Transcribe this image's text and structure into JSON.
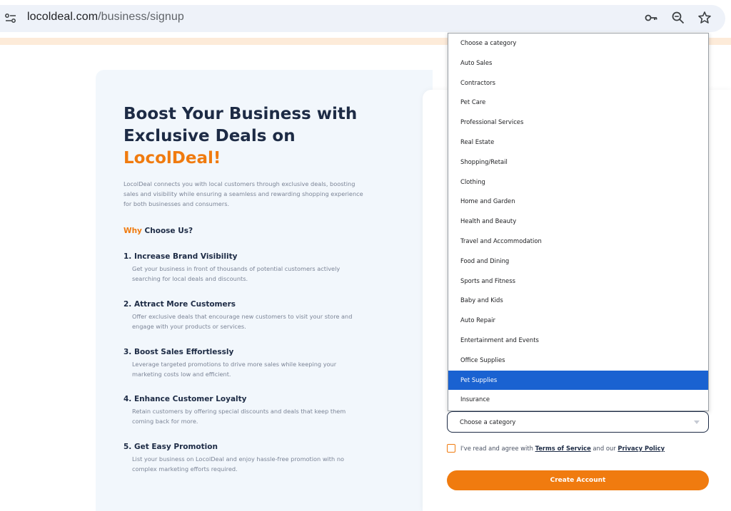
{
  "browser": {
    "url_domain": "locoldeal.com",
    "url_path": "/business/signup"
  },
  "hero": {
    "headline_line1": "Boost Your Business with",
    "headline_line2": "Exclusive Deals on",
    "brand": "LocolDeal!",
    "intro": "LocolDeal connects you with local customers through exclusive deals, boosting sales and visibility while ensuring a seamless and rewarding shopping experience for both businesses and consumers.",
    "why_accent": "Why",
    "why_rest": " Choose Us?"
  },
  "benefits": [
    {
      "title": "1. Increase Brand Visibility",
      "desc": "Get your business in front of thousands of potential customers actively searching for local deals and discounts."
    },
    {
      "title": "2. Attract More Customers",
      "desc": "Offer exclusive deals that encourage new customers to visit your store and engage with your products or services."
    },
    {
      "title": "3. Boost Sales Effortlessly",
      "desc": "Leverage targeted promotions to drive more sales while keeping your marketing costs low and efficient."
    },
    {
      "title": "4. Enhance Customer Loyalty",
      "desc": "Retain customers by offering special discounts and deals that keep them coming back for more."
    },
    {
      "title": "5. Get Easy Promotion",
      "desc": "List your business on LocolDeal and enjoy hassle-free promotion with no complex marketing efforts required."
    }
  ],
  "category_dropdown": {
    "options": [
      "Choose a category",
      "Auto Sales",
      "Contractors",
      "Pet Care",
      "Professional Services",
      "Real Estate",
      "Shopping/Retail",
      "Clothing",
      "Home and Garden",
      "Health and Beauty",
      "Travel and Accommodation",
      "Food and Dining",
      "Sports and Fitness",
      "Baby and Kids",
      "Auto Repair",
      "Entertainment and Events",
      "Office Supplies",
      "Pet Supplies",
      "Insurance"
    ],
    "highlighted": "Pet Supplies",
    "selected_value": "Choose a category"
  },
  "agreement": {
    "prefix": "I've read and agree with ",
    "terms": "Terms of Service",
    "middle": " and our ",
    "privacy": "Privacy Policy"
  },
  "create_button": "Create Account",
  "colors": {
    "accent": "#f07b0f",
    "heading": "#1d2b45",
    "highlight": "#1a62d1"
  }
}
